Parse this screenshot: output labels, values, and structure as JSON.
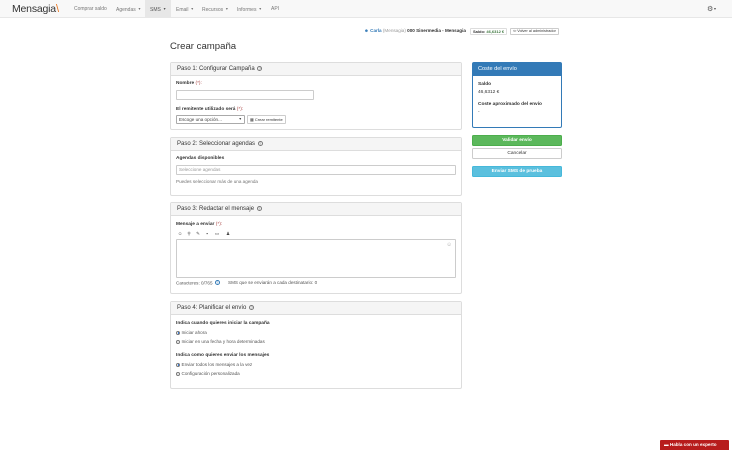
{
  "nav": {
    "brand": "Mensagia",
    "items": [
      {
        "label": "Comprar saldo",
        "caret": false
      },
      {
        "label": "Agendas",
        "caret": true
      },
      {
        "label": "SMS",
        "caret": true
      },
      {
        "label": "Email",
        "caret": true
      },
      {
        "label": "Recursos",
        "caret": true
      },
      {
        "label": "Informes",
        "caret": true
      },
      {
        "label": "API",
        "caret": false
      }
    ],
    "active": "SMS"
  },
  "account": {
    "user": "Carla",
    "user_sub": "(Mensagia)",
    "company": "000 Sinermedia - Mensagia",
    "saldo_label": "Saldo:",
    "saldo_value": "46,6312 €",
    "admin_button": "Volver al administrador"
  },
  "page_title": "Crear campaña",
  "step1": {
    "title": "Paso 1: Configurar Campaña",
    "name_label": "Nombre",
    "name_value": "",
    "sender_label": "El remitente utilizado será",
    "sender_placeholder": "Escoge una opción...",
    "create_sender": "Crear remitente",
    "required_mark": "(*):"
  },
  "step2": {
    "title": "Paso 2: Seleccionar agendas",
    "agendas_label": "Agendas disponibles",
    "agendas_placeholder": "Seleccione agendas",
    "help": "Puedes seleccionar más de una agenda"
  },
  "step3": {
    "title": "Paso 3: Redactar el mensaje",
    "message_label": "Mensaje a enviar",
    "required_mark": "(*):",
    "chars_label": "Caracteres: 0/765",
    "sms_count": "SMS que se enviarán a cada destinatario: 0"
  },
  "step4": {
    "title": "Paso 4: Planificar el envío",
    "when_label": "Indica cuando quieres iniciar la campaña",
    "when_options": [
      {
        "label": "Iniciar ahora",
        "checked": true
      },
      {
        "label": "Iniciar en una fecha y hora determinadas",
        "checked": false
      }
    ],
    "how_label": "Indica como quieres enviar los mensajes",
    "how_options": [
      {
        "label": "Enviar todos los mensajes a la vez",
        "checked": true
      },
      {
        "label": "Configuración personalizada",
        "checked": false
      }
    ]
  },
  "cost": {
    "title": "Coste del envío",
    "saldo_label": "Saldo",
    "saldo_value": "46,6312 €",
    "approx_label": "Coste aproximado del envío",
    "approx_value": "-"
  },
  "actions": {
    "validate": "Validar envío",
    "cancel": "Cancelar",
    "test": "Enviar SMS de prueba"
  },
  "chat": "Habla con un experto"
}
